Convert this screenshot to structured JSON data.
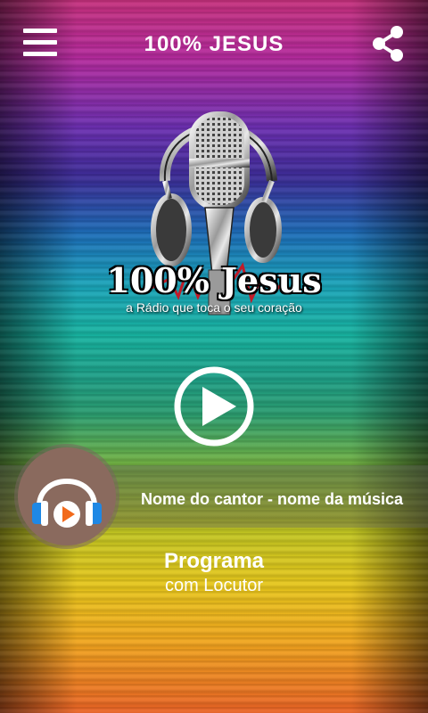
{
  "header": {
    "title": "100% JESUS",
    "menu_icon": "hamburger-menu-icon",
    "share_icon": "share-icon"
  },
  "logo": {
    "title": "100% Jesus",
    "subtitle": "a Rádio que toca o seu coração",
    "image": "microphone-with-headphones"
  },
  "player": {
    "play_icon": "play-icon",
    "now_playing": "Nome do cantor - nome da música",
    "avatar_icon": "headphones-play-icon"
  },
  "program": {
    "name": "Programa",
    "host": "com Locutor"
  },
  "colors": {
    "bar": "#505050",
    "avatar_bg": "#8a6a5e",
    "headphone_blue": "#1e88e5",
    "play_orange": "#f26a1b"
  }
}
